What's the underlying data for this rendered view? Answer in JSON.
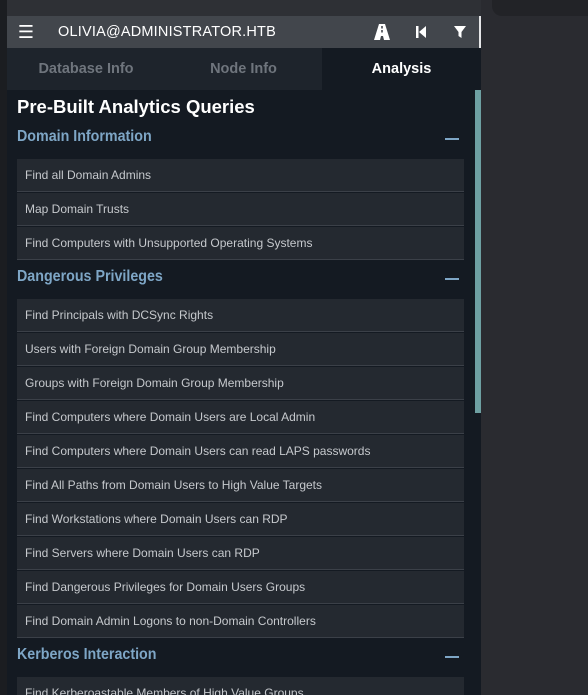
{
  "header": {
    "user": "OLIVIA@ADMINISTRATOR.HTB",
    "menu_icon": "hamburger-icon",
    "buttons": [
      "path-finding-icon",
      "back-icon",
      "filter-icon"
    ]
  },
  "tabs": [
    {
      "label": "Database Info",
      "active": false
    },
    {
      "label": "Node Info",
      "active": false
    },
    {
      "label": "Analysis",
      "active": true
    }
  ],
  "analysis": {
    "title": "Pre-Built Analytics Queries",
    "sections": [
      {
        "title": "Domain Information",
        "queries": [
          "Find all Domain Admins",
          "Map Domain Trusts",
          "Find Computers with Unsupported Operating Systems"
        ]
      },
      {
        "title": "Dangerous Privileges",
        "queries": [
          "Find Principals with DCSync Rights",
          "Users with Foreign Domain Group Membership",
          "Groups with Foreign Domain Group Membership",
          "Find Computers where Domain Users are Local Admin",
          "Find Computers where Domain Users can read LAPS passwords",
          "Find All Paths from Domain Users to High Value Targets",
          "Find Workstations where Domain Users can RDP",
          "Find Servers where Domain Users can RDP",
          "Find Dangerous Privileges for Domain Users Groups",
          "Find Domain Admin Logons to non-Domain Controllers"
        ]
      },
      {
        "title": "Kerberos Interaction",
        "queries": [
          "Find Kerberoastable Members of High Value Groups"
        ]
      }
    ]
  },
  "colors": {
    "header_bg": "#42464c",
    "panel_bg": "#141a22",
    "section_title": "#7ea6c6",
    "query_bg": "#242930",
    "scrollbar": "#6ea0a2"
  }
}
